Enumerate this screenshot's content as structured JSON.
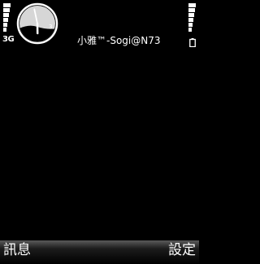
{
  "status": {
    "network": "3G",
    "operator": "小雅™-Sogi@N73",
    "signal_icon": "signal-strength-icon",
    "battery_icon": "battery-icon"
  },
  "clock": {
    "type": "analog",
    "dial_number": "3",
    "hour": 5,
    "minute": 58
  },
  "softkeys": {
    "left": "訊息",
    "right": "設定"
  },
  "colors": {
    "background": "#000000",
    "text": "#ffffff",
    "clock_face": "#d9d9d9"
  }
}
